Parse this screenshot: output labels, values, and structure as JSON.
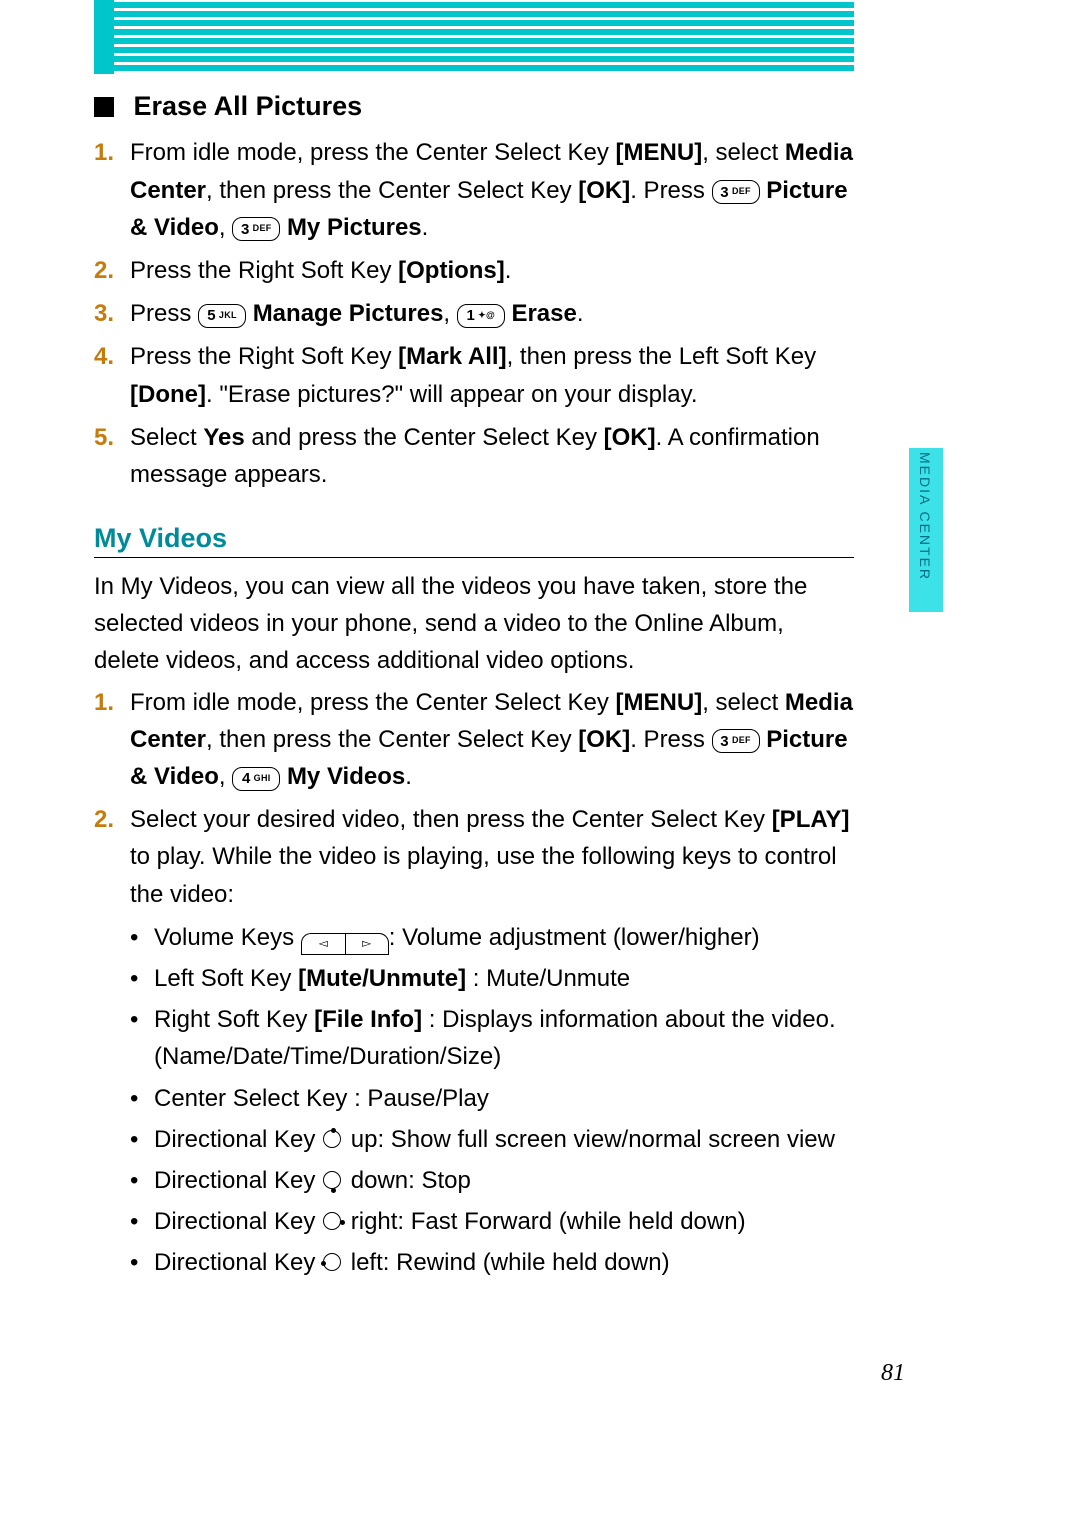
{
  "meta": {
    "side_tab": "MEDIA CENTER",
    "page_number": "81"
  },
  "sections": {
    "erase_all_pictures": {
      "title": "Erase All Pictures",
      "steps": [
        {
          "n": "1.",
          "parts": [
            {
              "t": "From idle mode, press the Center Select Key "
            },
            {
              "b": "[MENU]"
            },
            {
              "t": ", select "
            },
            {
              "b": "Media Center"
            },
            {
              "t": ", then press the Center Select Key "
            },
            {
              "b": "[OK]"
            },
            {
              "t": ". Press "
            },
            {
              "k": {
                "big": "3",
                "sub": "DEF"
              }
            },
            {
              "t": " "
            },
            {
              "b": "Picture & Video"
            },
            {
              "t": ", "
            },
            {
              "k": {
                "big": "3",
                "sub": "DEF"
              }
            },
            {
              "t": " "
            },
            {
              "b": "My Pictures"
            },
            {
              "t": "."
            }
          ]
        },
        {
          "n": "2.",
          "parts": [
            {
              "t": "Press the Right Soft Key "
            },
            {
              "b": "[Options]"
            },
            {
              "t": "."
            }
          ]
        },
        {
          "n": "3.",
          "parts": [
            {
              "t": "Press "
            },
            {
              "k": {
                "big": "5",
                "sub": "JKL"
              }
            },
            {
              "t": " "
            },
            {
              "b": "Manage Pictures"
            },
            {
              "t": ", "
            },
            {
              "k": {
                "big": "1",
                "sub": "✦@"
              }
            },
            {
              "t": " "
            },
            {
              "b": "Erase"
            },
            {
              "t": "."
            }
          ]
        },
        {
          "n": "4.",
          "parts": [
            {
              "t": "Press the Right Soft Key "
            },
            {
              "b": "[Mark All]"
            },
            {
              "t": ", then press the Left Soft Key "
            },
            {
              "b": "[Done]"
            },
            {
              "t": ". \"Erase pictures?\" will appear on your display."
            }
          ]
        },
        {
          "n": "5.",
          "parts": [
            {
              "t": "Select "
            },
            {
              "b": "Yes"
            },
            {
              "t": " and press the Center Select Key "
            },
            {
              "b": "[OK]"
            },
            {
              "t": ". A confirmation message appears."
            }
          ]
        }
      ]
    },
    "my_videos": {
      "title": "My Videos",
      "intro": "In My Videos, you can view all the videos you have taken, store the selected videos in your phone, send a video to the Online Album, delete videos, and access additional video options.",
      "steps": [
        {
          "n": "1.",
          "parts": [
            {
              "t": "From idle mode, press the Center Select Key "
            },
            {
              "b": "[MENU]"
            },
            {
              "t": ", select "
            },
            {
              "b": "Media Center"
            },
            {
              "t": ", then press the Center Select Key "
            },
            {
              "b": "[OK]"
            },
            {
              "t": ". Press "
            },
            {
              "k": {
                "big": "3",
                "sub": "DEF"
              }
            },
            {
              "t": " "
            },
            {
              "b": "Picture & Video"
            },
            {
              "t": ", "
            },
            {
              "k": {
                "big": "4",
                "sub": "GHI"
              }
            },
            {
              "t": " "
            },
            {
              "b": "My Videos"
            },
            {
              "t": "."
            }
          ]
        },
        {
          "n": "2.",
          "parts": [
            {
              "t": "Select your desired video, then press the Center Select Key "
            },
            {
              "b": "[PLAY]"
            },
            {
              "t": " to play. While the video is playing, use the following keys to control the video:"
            }
          ]
        }
      ],
      "bullets": [
        {
          "parts": [
            {
              "t": "Volume Keys "
            },
            {
              "vol": true
            },
            {
              "t": ": Volume adjustment (lower/higher)"
            }
          ]
        },
        {
          "parts": [
            {
              "t": "Left Soft Key "
            },
            {
              "b": "[Mute/Unmute]"
            },
            {
              "t": " : Mute/Unmute"
            }
          ]
        },
        {
          "parts": [
            {
              "t": "Right Soft Key "
            },
            {
              "b": "[File Info]"
            },
            {
              "t": " : Displays information about the video. (Name/Date/Time/Duration/Size)"
            }
          ]
        },
        {
          "parts": [
            {
              "t": "Center Select Key : Pause/Play"
            }
          ]
        },
        {
          "parts": [
            {
              "t": "Directional Key "
            },
            {
              "dk": "up"
            },
            {
              "t": " up: Show full screen view/normal screen view"
            }
          ]
        },
        {
          "parts": [
            {
              "t": "Directional Key "
            },
            {
              "dk": "down"
            },
            {
              "t": " down: Stop"
            }
          ]
        },
        {
          "parts": [
            {
              "t": "Directional Key "
            },
            {
              "dk": "right"
            },
            {
              "t": " right: Fast Forward (while held down)"
            }
          ]
        },
        {
          "parts": [
            {
              "t": "Directional Key "
            },
            {
              "dk": "left"
            },
            {
              "t": " left: Rewind (while held down)"
            }
          ]
        }
      ]
    }
  }
}
